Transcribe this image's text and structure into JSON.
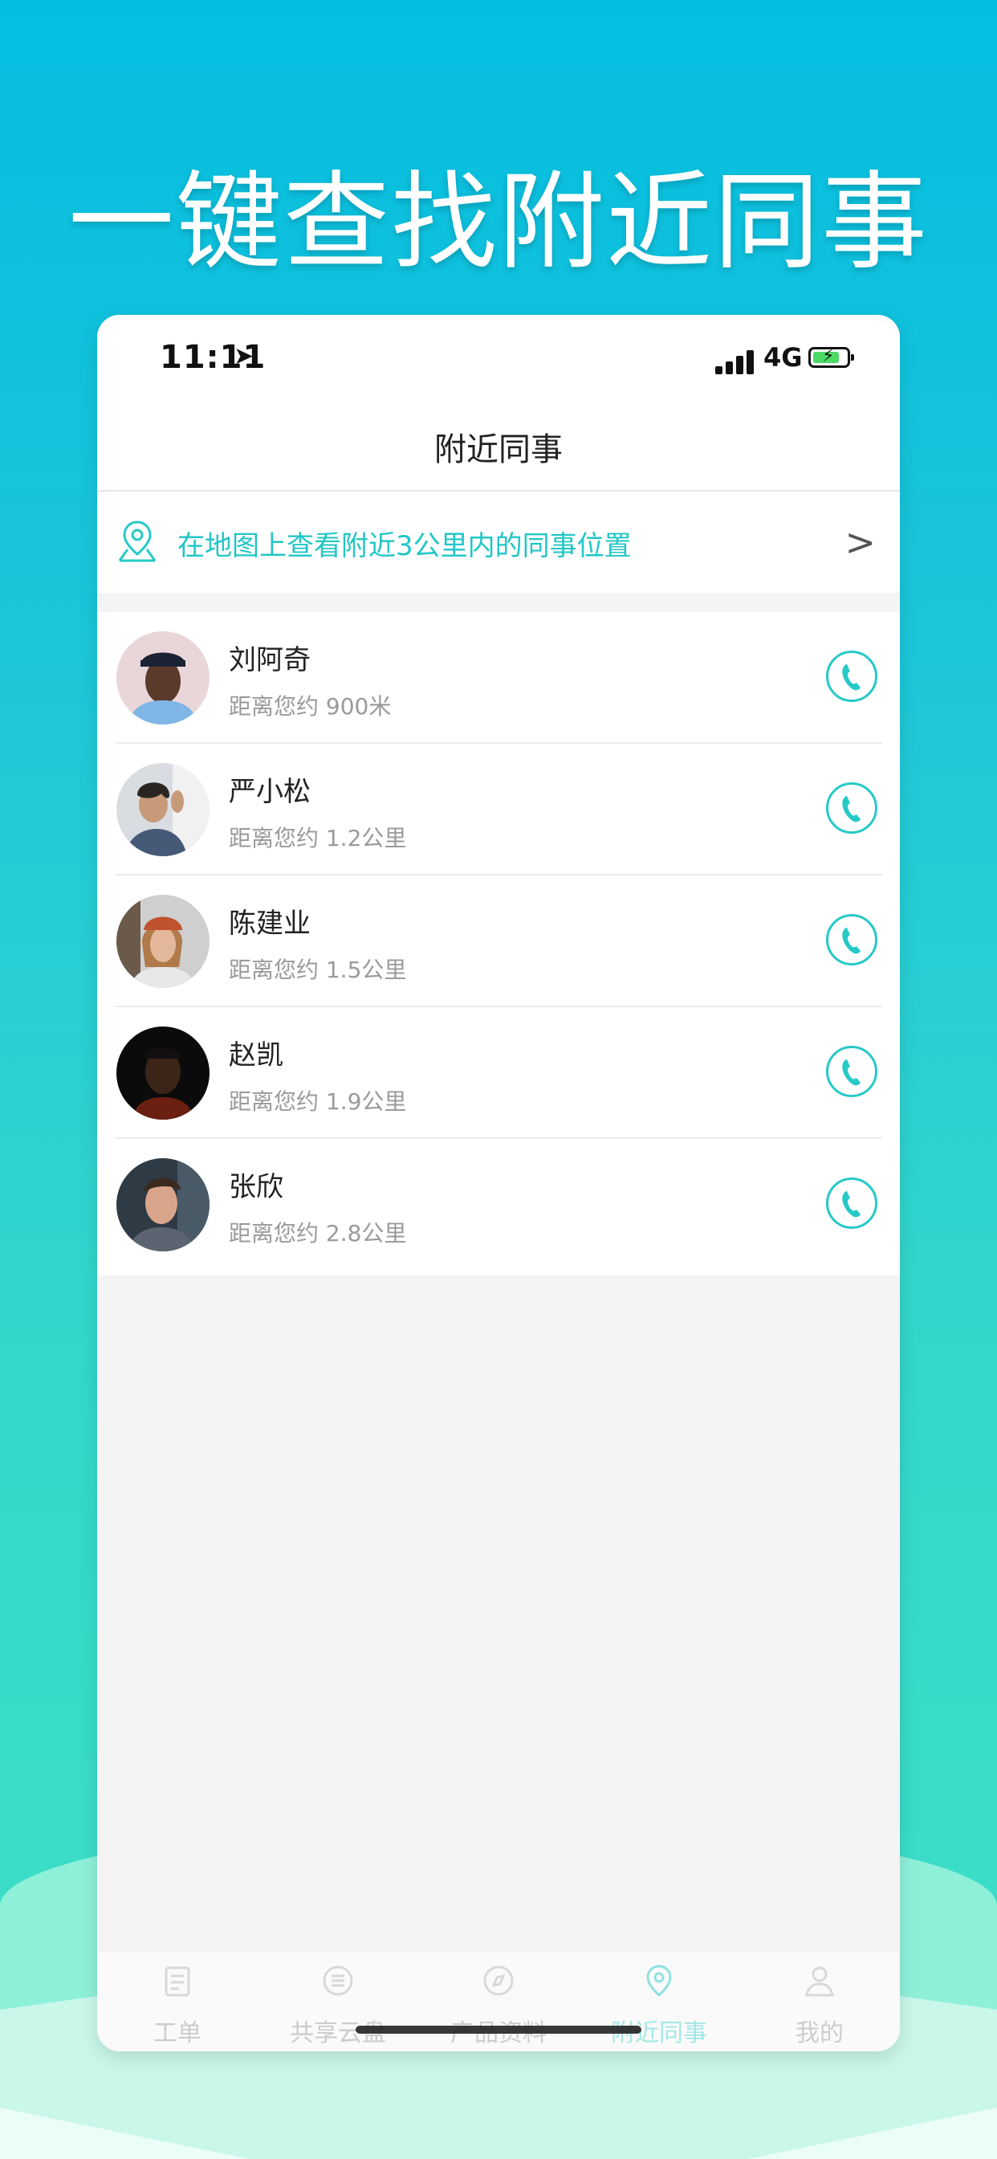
{
  "headline": "一键查找附近同事",
  "status": {
    "time": "11:11",
    "network": "4G"
  },
  "nav": {
    "title": "附近同事"
  },
  "map_link": {
    "text": "在地图上查看附近3公里内的同事位置"
  },
  "colleagues": [
    {
      "name": "刘阿奇",
      "distance": "距离您约 900米"
    },
    {
      "name": "严小松",
      "distance": "距离您约 1.2公里"
    },
    {
      "name": "陈建业",
      "distance": "距离您约 1.5公里"
    },
    {
      "name": "赵凯",
      "distance": "距离您约 1.9公里"
    },
    {
      "name": "张欣",
      "distance": "距离您约 2.8公里"
    }
  ],
  "tabs": [
    {
      "label": "工单",
      "icon": "clipboard-icon"
    },
    {
      "label": "共享云盘",
      "icon": "cloud-disk-icon"
    },
    {
      "label": "产品资料",
      "icon": "compass-icon"
    },
    {
      "label": "附近同事",
      "icon": "location-icon",
      "active": true
    },
    {
      "label": "我的",
      "icon": "person-icon"
    }
  ],
  "colors": {
    "accent": "#26c9c7",
    "background_top": "#04bde0",
    "background_bottom": "#3fe0c6"
  }
}
